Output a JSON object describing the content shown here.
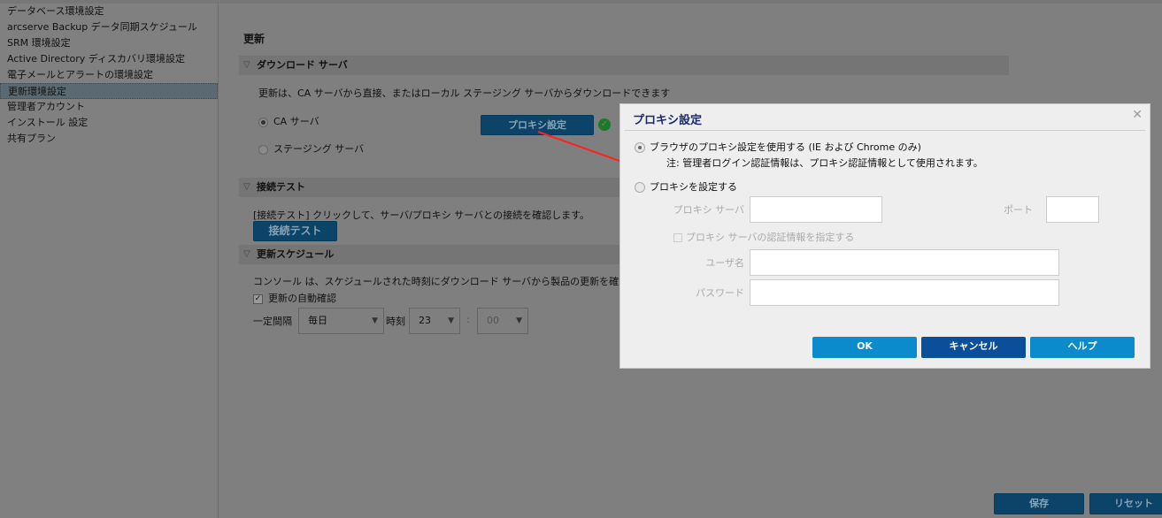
{
  "sidebar": {
    "items": [
      "データベース環境設定",
      "arcserve Backup データ同期スケジュール",
      "SRM 環境設定",
      "Active Directory ディスカバリ環境設定",
      "電子メールとアラートの環境設定",
      "更新環境設定",
      "管理者アカウント",
      "インストール 設定",
      "共有プラン"
    ],
    "selected_index": 5
  },
  "main": {
    "title": "更新",
    "download": {
      "header": "ダウンロード サーバ",
      "desc": "更新は、CA サーバから直接、またはローカル ステージング サーバからダウンロードできます",
      "ca_server": "CA サーバ",
      "staging_server": "ステージング サーバ",
      "proxy_button": "プロキシ設定"
    },
    "test": {
      "header": "接続テスト",
      "desc": "[接続テスト] クリックして、サーバ/プロキシ サーバとの接続を確認します。",
      "button": "接続テスト"
    },
    "schedule": {
      "header": "更新スケジュール",
      "desc": "コンソール は、スケジュールされた時刻にダウンロード サーバから製品の更新を確認できます",
      "auto_check": "更新の自動確認",
      "interval_label": "一定間隔",
      "interval_value": "毎日",
      "time_label": "時刻",
      "hour": "23",
      "colon": ":",
      "minute": "00"
    },
    "save": "保存",
    "reset": "リセット"
  },
  "dialog": {
    "title": "プロキシ設定",
    "use_browser": "ブラウザのプロキシ設定を使用する (IE および Chrome のみ)",
    "note": "注: 管理者ログイン認証情報は、プロキシ認証情報として使用されます。",
    "configure": "プロキシを設定する",
    "proxy_server_label": "プロキシ サーバ",
    "port_label": "ポート",
    "auth_check": "プロキシ サーバの認証情報を指定する",
    "username_label": "ユーザ名",
    "password_label": "パスワード",
    "ok": "OK",
    "cancel": "キャンセル",
    "help": "ヘルプ"
  },
  "colors": {
    "accent": "#0b8bcb",
    "cancel": "#0b4f9b",
    "annotation": "#ff2020"
  }
}
